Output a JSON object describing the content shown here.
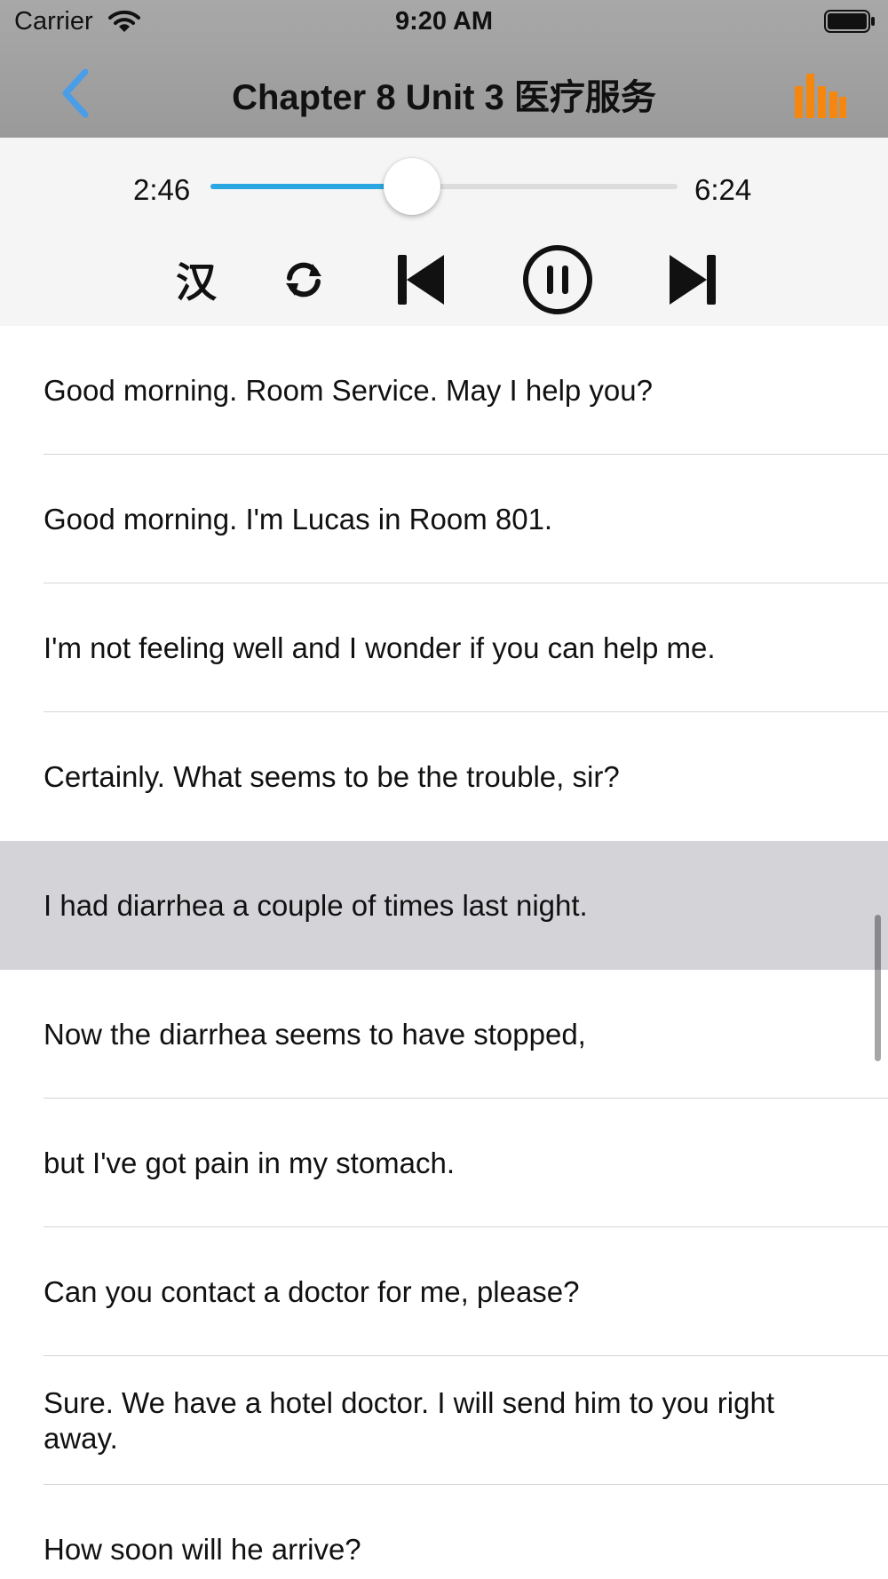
{
  "status_bar": {
    "carrier": "Carrier",
    "time": "9:20 AM"
  },
  "nav": {
    "title": "Chapter 8 Unit 3 医疗服务",
    "back_icon": "chevron-left-icon",
    "menu_icon": "equalizer-bars-icon",
    "accent_color": "#4a9ee8",
    "menu_color": "#f5870f"
  },
  "player": {
    "elapsed": "2:46",
    "total": "6:24",
    "progress": 0.4323,
    "fill_color": "#2aa6e0",
    "han_label": "汉",
    "loop_icon": "repeat-icon",
    "prev_icon": "skip-previous-icon",
    "pause_icon": "pause-circle-icon",
    "next_icon": "skip-next-icon"
  },
  "transcript": {
    "active_index": 4,
    "lines": [
      "Good morning. Room Service. May I help you?",
      "Good morning. I'm Lucas in Room 801.",
      "I'm not feeling well and I wonder if you can help me.",
      "Certainly. What seems to be the trouble, sir?",
      "I had diarrhea a couple of times last night.",
      "Now the diarrhea seems to have stopped,",
      "but I've got pain in my stomach.",
      "Can you contact a doctor for me, please?",
      "Sure. We have a hotel doctor. I will send him to you right away.",
      "How soon will he arrive?"
    ]
  }
}
